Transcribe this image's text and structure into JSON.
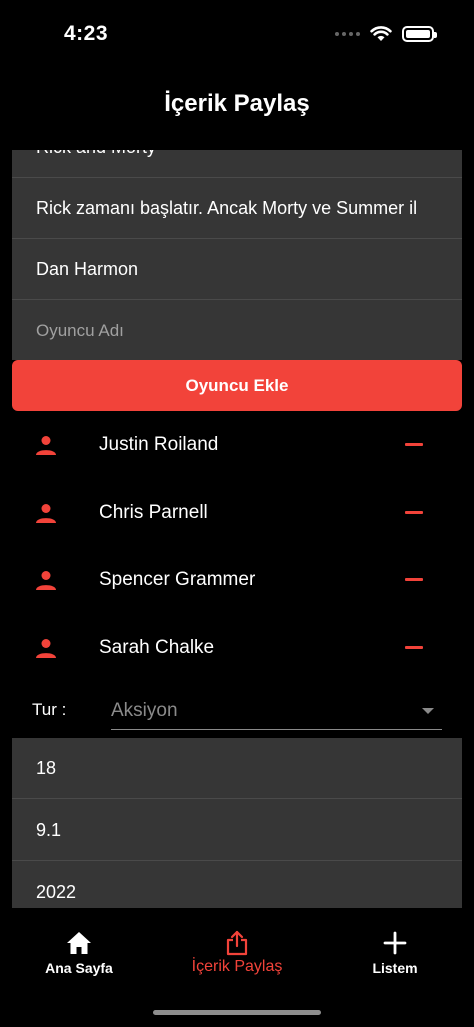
{
  "status_bar": {
    "time": "4:23"
  },
  "header": {
    "title": "İçerik Paylaş"
  },
  "form": {
    "title_value": "Rick and Morty",
    "description_value": "Rick zamanı başlatır. Ancak Morty ve Summer il",
    "director_value": "Dan Harmon",
    "actor_placeholder": "Oyuncu Adı",
    "add_actor_label": "Oyuncu Ekle"
  },
  "actors": [
    {
      "name": "Justin Roiland"
    },
    {
      "name": "Chris Parnell"
    },
    {
      "name": "Spencer Grammer"
    },
    {
      "name": "Sarah Chalke"
    }
  ],
  "genre": {
    "label": "Tur :",
    "selected": "Aksiyon"
  },
  "details": {
    "age_value": "18",
    "rating_value": "9.1",
    "year_value": "2022"
  },
  "tab_bar": {
    "tabs": [
      {
        "label": "Ana Sayfa",
        "icon": "home-icon"
      },
      {
        "label": "İçerik Paylaş",
        "icon": "share-icon"
      },
      {
        "label": "Listem",
        "icon": "plus-icon"
      }
    ]
  },
  "colors": {
    "accent": "#f2433a",
    "field_bg": "#363636",
    "background": "#000000"
  }
}
